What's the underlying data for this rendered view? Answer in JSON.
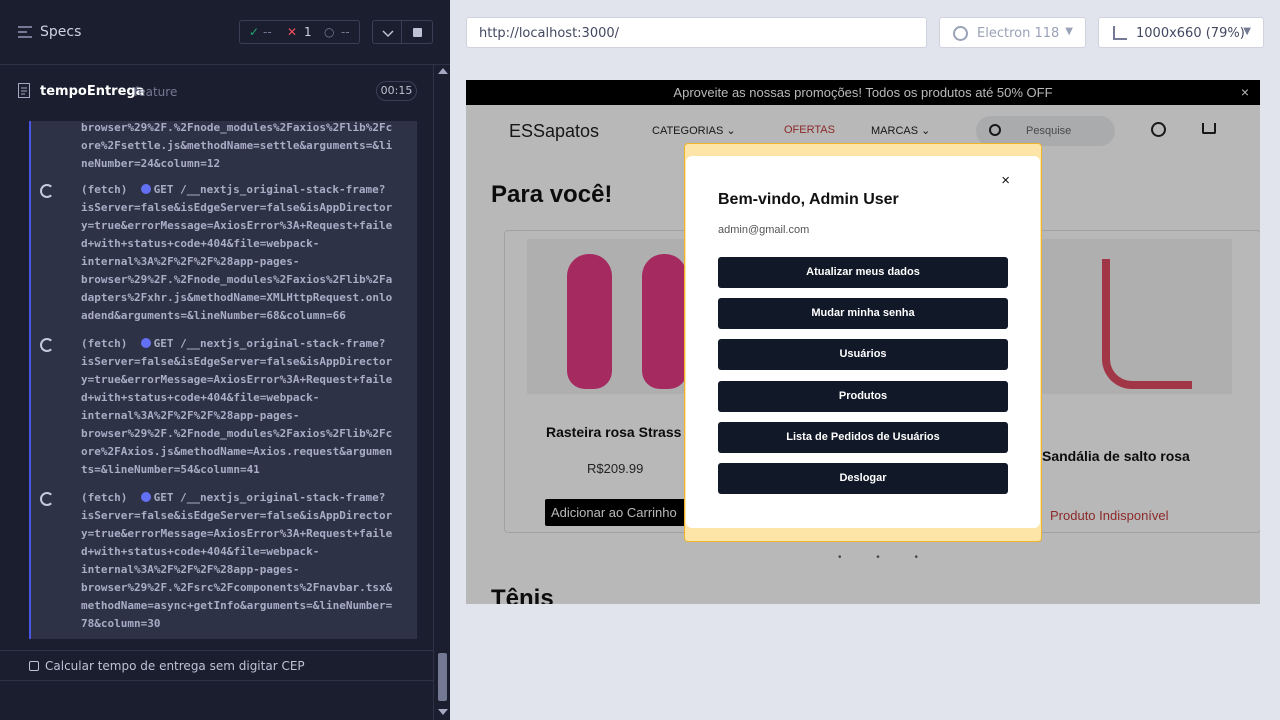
{
  "runner": {
    "specs_label": "Specs",
    "stats": {
      "passed": "--",
      "failed": "1",
      "pending": "--"
    },
    "spec_file": {
      "name": "tempoEntrega",
      "type": "feature",
      "time": "00:15"
    },
    "log": [
      {
        "text": "browser%29%2F.%2Fnode_modules%2Faxios%2Flib%2Fc\nore%2Fsettle.js&methodName=settle&arguments=&li\nneNumber=24&column=12"
      },
      {
        "prefix": "(fetch)",
        "method": "GET",
        "text": "/__nextjs_original-stack-frame?\nisServer=false&isEdgeServer=false&isAppDirector\ny=true&errorMessage=AxiosError%3A+Request+faile\nd+with+status+code+404&file=webpack-\ninternal%3A%2F%2F%2F%28app-pages-\nbrowser%29%2F.%2Fnode_modules%2Faxios%2Flib%2Fa\ndapters%2Fxhr.js&methodName=XMLHttpRequest.onlo\nadend&arguments=&lineNumber=68&column=66"
      },
      {
        "prefix": "(fetch)",
        "method": "GET",
        "text": "/__nextjs_original-stack-frame?\nisServer=false&isEdgeServer=false&isAppDirector\ny=true&errorMessage=AxiosError%3A+Request+faile\nd+with+status+code+404&file=webpack-\ninternal%3A%2F%2F%2F%28app-pages-\nbrowser%29%2F.%2Fnode_modules%2Faxios%2Flib%2Fc\nore%2FAxios.js&methodName=Axios.request&argumen\nts=&lineNumber=54&column=41"
      },
      {
        "prefix": "(fetch)",
        "method": "GET",
        "text": "/__nextjs_original-stack-frame?\nisServer=false&isEdgeServer=false&isAppDirector\ny=true&errorMessage=AxiosError%3A+Request+faile\nd+with+status+code+404&file=webpack-\ninternal%3A%2F%2F%2F%28app-pages-\nbrowser%29%2F.%2Fsrc%2Fcomponents%2Fnavbar.tsx&\nmethodName=async+getInfo&arguments=&lineNumber=\n78&column=30"
      }
    ],
    "test_title": "Calcular tempo de entrega sem digitar CEP"
  },
  "browser": {
    "url": "http://localhost:3000/",
    "engine": "Electron 118",
    "viewport": "1000x660",
    "zoom": "(79%)"
  },
  "app": {
    "promo": "Aproveite as nossas promoções! Todos os produtos até 50% OFF",
    "promo_close": "×",
    "logo": "ESSapatos",
    "nav": {
      "categorias": "CATEGORIAS",
      "ofertas": "OFERTAS",
      "marcas": "MARCAS",
      "chevron": "⌄"
    },
    "search_placeholder": "Pesquise",
    "section_title": "Para você!",
    "products": [
      {
        "name": "Rasteira rosa Strass",
        "price": "R$209.99",
        "action": "Adicionar ao Carrinho"
      },
      {
        "name": "Sandália de salto rosa",
        "status": "Produto Indisponível"
      }
    ],
    "carousel_dots": "• • •",
    "section_title_2": "Tênis"
  },
  "modal": {
    "close": "×",
    "title": "Bem-vindo, Admin User",
    "email": "admin@gmail.com",
    "buttons": [
      "Atualizar meus dados",
      "Mudar minha senha",
      "Usuários",
      "Produtos",
      "Lista de Pedidos de Usuários",
      "Deslogar"
    ]
  },
  "colors": {
    "runner_bg": "#1b1e2e",
    "log_bg": "#2e3247",
    "accent": "#4956e3",
    "fail": "#f24e5c",
    "modal_button": "#111827",
    "highlight": "#f0b429",
    "sale_red": "#c23a3a"
  },
  "icons": [
    "specs-icon",
    "check-icon",
    "x-icon",
    "pending-icon",
    "chevron-down-icon",
    "stop-icon",
    "file-icon",
    "spinner-icon",
    "electron-icon",
    "viewport-icon",
    "search-icon",
    "user-icon",
    "cart-icon",
    "close-icon"
  ]
}
